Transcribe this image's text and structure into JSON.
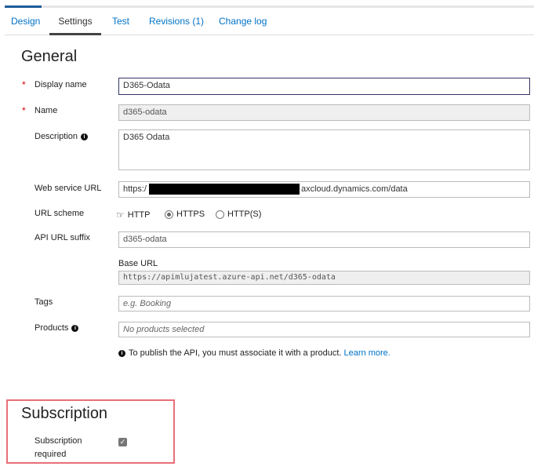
{
  "tabs": [
    "Design",
    "Settings",
    "Test",
    "Revisions (1)",
    "Change log"
  ],
  "active_tab": "Settings",
  "general": {
    "title": "General",
    "display_name": {
      "label": "Display name",
      "value": "D365-Odata"
    },
    "name": {
      "label": "Name",
      "value": "d365-odata"
    },
    "description": {
      "label": "Description",
      "value": "D365 Odata"
    },
    "web_service_url": {
      "label": "Web service URL",
      "prefix": "https:/",
      "suffix": "axcloud.dynamics.com/data"
    },
    "url_scheme": {
      "label": "URL scheme",
      "options": [
        "HTTP",
        "HTTPS",
        "HTTP(S)"
      ],
      "selected": "HTTPS"
    },
    "api_url_suffix": {
      "label": "API URL suffix",
      "value": "d365-odata"
    },
    "base_url": {
      "label": "Base URL",
      "value": "https://apimlujatest.azure-api.net/d365-odata"
    },
    "tags": {
      "label": "Tags",
      "placeholder": "e.g. Booking"
    },
    "products": {
      "label": "Products",
      "placeholder": "No products selected"
    },
    "note": "To publish the API, you must associate it with a product.",
    "learn_more": "Learn more."
  },
  "subscription": {
    "title": "Subscription",
    "label_line1": "Subscription",
    "label_line2": "required",
    "checked": true
  }
}
